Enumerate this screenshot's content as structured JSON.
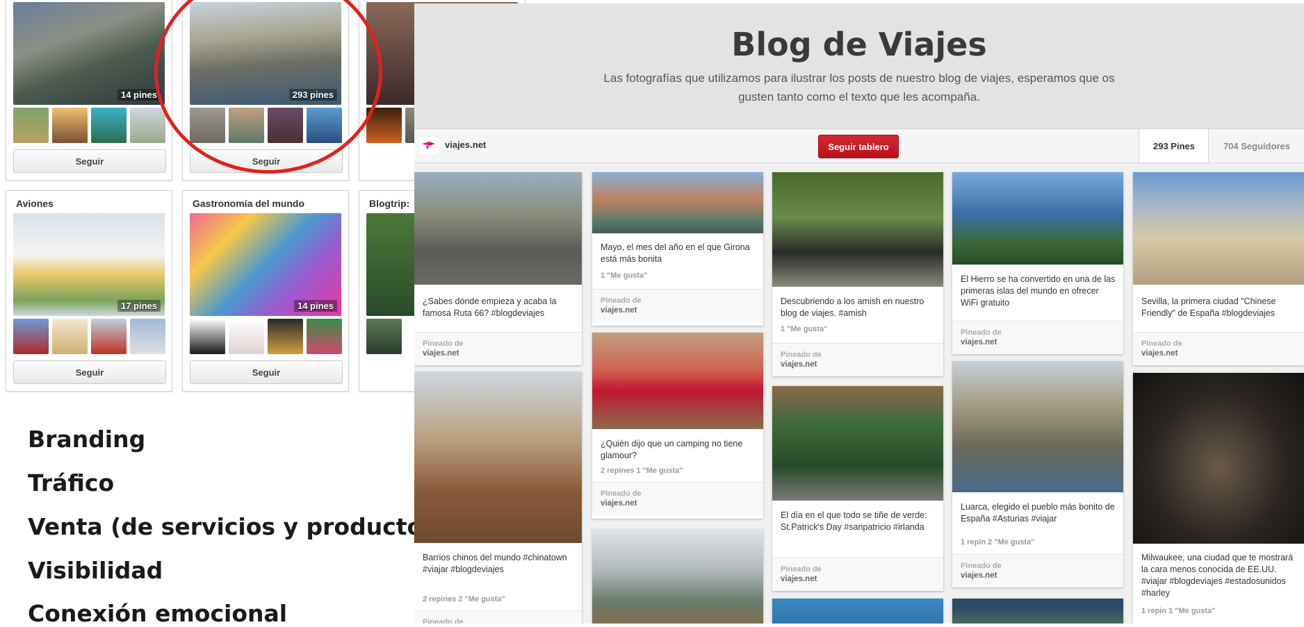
{
  "boards_top": [
    {
      "count": "14 pines",
      "follow_label": "Seguir"
    },
    {
      "count": "293 pines",
      "follow_label": "Seguir"
    }
  ],
  "boards_bottom": [
    {
      "title": "Aviones",
      "count": "17 pines",
      "follow_label": "Seguir"
    },
    {
      "title": "Gastronomía del mundo",
      "count": "14 pines",
      "follow_label": "Seguir"
    },
    {
      "title": "Blogtrip:"
    }
  ],
  "bullets": [
    "Branding",
    "Tráfico",
    "Venta (de servicios y productos)",
    "Visibilidad",
    "Conexión emocional"
  ],
  "panel": {
    "title": "Blog de Viajes",
    "description": "Las fotografías que utilizamos para ilustrar los posts de nuestro blog de viajes, esperamos que os gusten tanto como el texto que les acompaña.",
    "user": "viajes.net",
    "follow_board_label": "Seguir tablero",
    "pins_stat": "293 Pines",
    "followers_stat": "704 Seguidores"
  },
  "pins": [
    {
      "desc": "¿Sabes dónde empieza y acaba la famosa Ruta 66? #blogdeviajes",
      "stats": "",
      "foot_label": "Pineado de",
      "foot_user": "viajes.net"
    },
    {
      "desc": "Barrios chinos del mundo #chinatown #viajar #blogdeviajes",
      "stats": "2 repines   2 \"Me gusta\"",
      "foot_label": "Pineado de",
      "foot_user": ""
    },
    {
      "desc": "Mayo, el mes del año en el que Girona está más bonita",
      "stats": "1 \"Me gusta\"",
      "foot_label": "Pineado de",
      "foot_user": "viajes.net"
    },
    {
      "desc": "¿Quién dijo que un camping no tiene glamour?",
      "stats": "2 repines   1 \"Me gusta\"",
      "foot_label": "Pineado de",
      "foot_user": "viajes.net"
    },
    {
      "desc": "Descubriendo a los amish en nuestro blog de viajes. #amish",
      "stats": "1 \"Me gusta\"",
      "foot_label": "Pineado de",
      "foot_user": "viajes.net"
    },
    {
      "desc": "El día en el que todo se tiñe de verde: St.Patrick's Day #sanpatricio #irlanda",
      "stats": "",
      "foot_label": "Pineado de",
      "foot_user": "viajes.net"
    },
    {
      "desc": "El Hierro se ha convertido en una de las primeras islas del mundo en ofrecer WiFi gratuito",
      "stats": "",
      "foot_label": "Pineado de",
      "foot_user": "viajes.net"
    },
    {
      "desc": "Luarca, elegido el pueblo más bonito de España #Asturias #viajar",
      "stats": "1 repin   2 \"Me gusta\"",
      "foot_label": "Pineado de",
      "foot_user": "viajes.net"
    },
    {
      "desc": "Sevilla, la primera ciudad \"Chinese Friendly\" de España #blogdeviajes",
      "stats": "",
      "foot_label": "Pineado de",
      "foot_user": "viajes.net"
    },
    {
      "desc": "Milwaukee, una ciudad que te mostrará la cara menos conocida de EE.UU. #viajar #blogdeviajes #estadosunidos #harley",
      "stats": "1 repin   1 \"Me gusta\"",
      "foot_label": "",
      "foot_user": ""
    }
  ],
  "colors": {
    "accent_red": "#c8161f",
    "circle_red": "#e0221b"
  }
}
